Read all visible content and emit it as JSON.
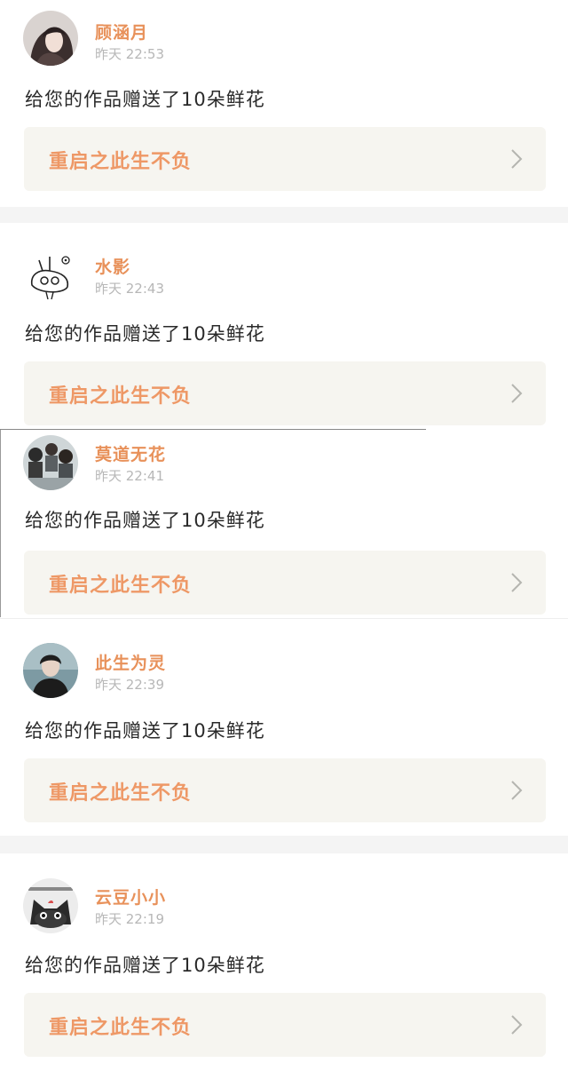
{
  "notifications": [
    {
      "user": "顾涵月",
      "time": "昨天 22:53",
      "message": "给您的作品赠送了10朵鲜花",
      "work_title": "重启之此生不负",
      "avatar_icon": "girl-portrait"
    },
    {
      "user": "水影",
      "time": "昨天 22:43",
      "message": "给您的作品赠送了10朵鲜花",
      "work_title": "重启之此生不负",
      "avatar_icon": "doodle-bunny"
    },
    {
      "user": "莫道无花",
      "time": "昨天 22:41",
      "message": "给您的作品赠送了10朵鲜花",
      "work_title": "重启之此生不负",
      "avatar_icon": "group-photo"
    },
    {
      "user": "此生为灵",
      "time": "昨天 22:39",
      "message": "给您的作品赠送了10朵鲜花",
      "work_title": "重启之此生不负",
      "avatar_icon": "boy-portrait"
    },
    {
      "user": "云豆小小",
      "time": "昨天 22:19",
      "message": "给您的作品赠送了10朵鲜花",
      "work_title": "重启之此生不负",
      "avatar_icon": "cartoon-cat"
    }
  ],
  "colors": {
    "username": "#e8915a",
    "work_title": "#ee9866",
    "card_bg": "#f6f5f0",
    "time": "#b7b7b7",
    "separator": "#f4f4f4"
  }
}
